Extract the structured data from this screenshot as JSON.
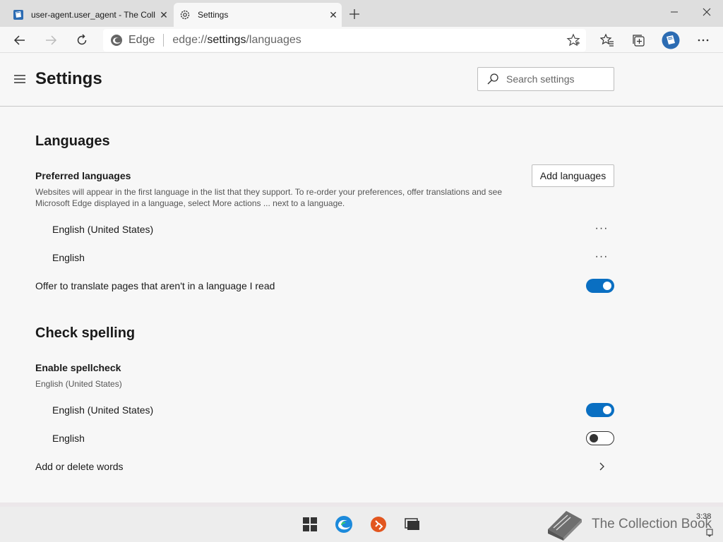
{
  "tabs": [
    {
      "title": "user-agent.user_agent - The Coll",
      "icon": "book-icon",
      "active": false
    },
    {
      "title": "Settings",
      "icon": "gear-icon",
      "active": true
    }
  ],
  "addressbar": {
    "brand": "Edge",
    "url_prefix": "edge://",
    "url_host": "settings",
    "url_path": "/languages"
  },
  "settings": {
    "title": "Settings",
    "search_placeholder": "Search settings"
  },
  "languages": {
    "heading": "Languages",
    "preferred_label": "Preferred languages",
    "preferred_desc": "Websites will appear in the first language in the list that they support. To re-order your preferences, offer translations and see Microsoft Edge displayed in a language, select More actions ... next to a language.",
    "add_button": "Add languages",
    "items": [
      "English (United States)",
      "English"
    ],
    "more_glyph": "···",
    "offer_translate_label": "Offer to translate pages that aren't in a language I read",
    "offer_translate_on": true
  },
  "spelling": {
    "heading": "Check spelling",
    "enable_label": "Enable spellcheck",
    "enable_sub": "English (United States)",
    "items": [
      {
        "label": "English (United States)",
        "on": true
      },
      {
        "label": "English",
        "on": false
      }
    ],
    "add_delete_label": "Add or delete words"
  },
  "taskbar": {
    "watermark": "The Collection Book",
    "clock": "3:38"
  },
  "colors": {
    "accent": "#0a6fc2",
    "tabstrip": "#dedede",
    "page_bg": "#f7f7f7"
  }
}
